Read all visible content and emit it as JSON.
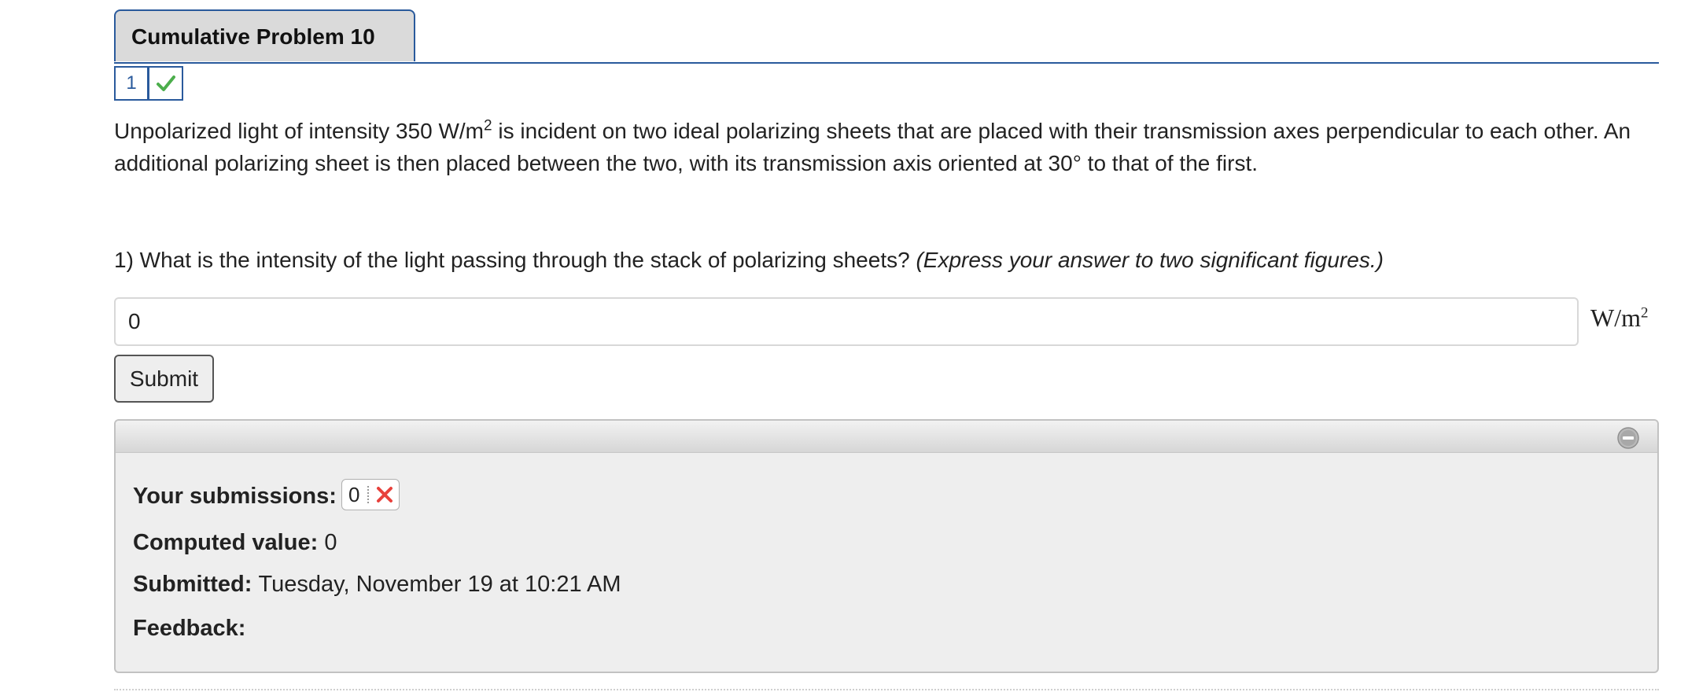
{
  "tab": {
    "title": "Cumulative Problem 10"
  },
  "attempts": {
    "number": "1",
    "status_icon": "check-icon",
    "status_color": "#4cae4c"
  },
  "problem": {
    "text_before_sup": "Unpolarized light of intensity 350 W/m",
    "sup": "2",
    "text_after_sup": " is incident on two ideal polarizing sheets that are placed with their transmission axes perpendicular to each other. An additional polarizing sheet is then placed between the two, with its transmission axis oriented at 30° to that of the first."
  },
  "question": {
    "text": "1) What is the intensity of the light passing through the stack of polarizing sheets? ",
    "hint": "(Express your answer to two significant figures.)"
  },
  "answer": {
    "value": "0",
    "unit_base": "W/m",
    "unit_sup": "2"
  },
  "submit": {
    "label": "Submit"
  },
  "panel": {
    "collapse_icon": "minus-circle-icon",
    "submissions_label": "Your submissions:",
    "submission_value": "0",
    "submission_status_icon": "x-icon",
    "submission_status_color": "#e8413c",
    "computed_label": "Computed value:",
    "computed_value": "0",
    "submitted_label": "Submitted:",
    "submitted_value": "Tuesday, November 19 at 10:21 AM",
    "feedback_label": "Feedback:",
    "feedback_value": ""
  }
}
